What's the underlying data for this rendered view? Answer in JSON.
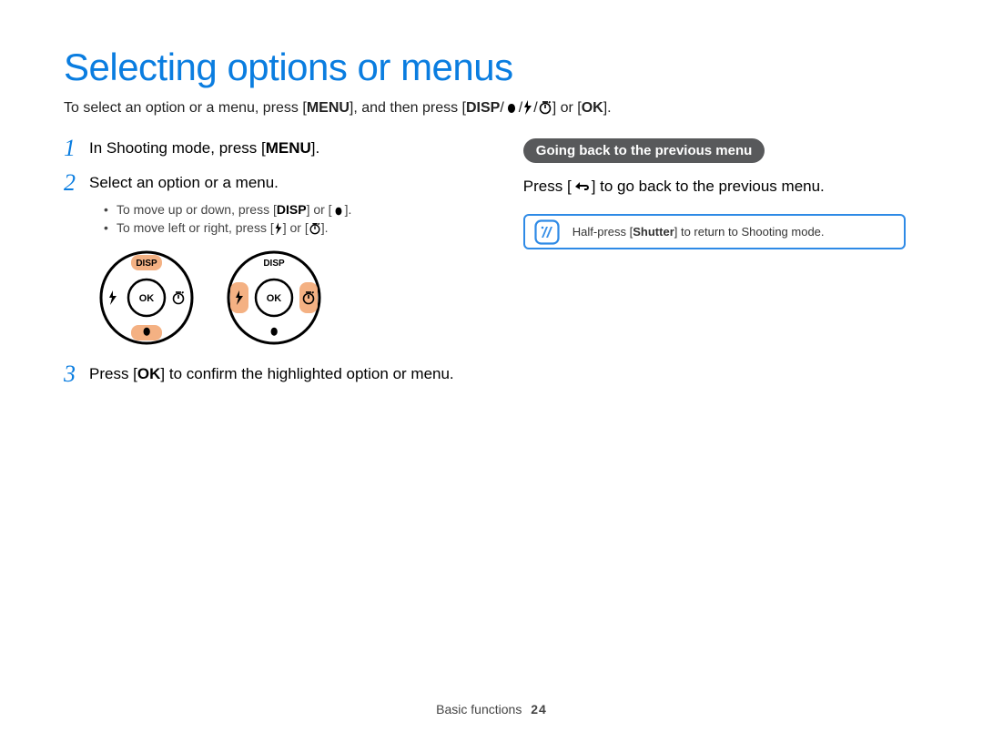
{
  "title": "Selecting options or menus",
  "intro": {
    "p1": "To select an option or a menu, press [",
    "menu": "MENU",
    "p2": "], and then press [",
    "disp": "DISP",
    "p3": "] or [",
    "ok": "OK",
    "p4": "]."
  },
  "steps": {
    "s1": {
      "num": "1",
      "t1": "In Shooting mode, press [",
      "menu": "MENU",
      "t2": "]."
    },
    "s2": {
      "num": "2",
      "text": "Select an option or a menu.",
      "b1": {
        "a": "To move up or down, press [",
        "disp": "DISP",
        "b": "] or [",
        "c": "]."
      },
      "b2": {
        "a": "To move left or right, press [",
        "b": "] or [",
        "c": "]."
      }
    },
    "s3": {
      "num": "3",
      "t1": "Press [",
      "ok": "OK",
      "t2": "] to confirm the highlighted option or menu."
    }
  },
  "diagrams": {
    "disp": "DISP",
    "ok": "OK"
  },
  "right": {
    "pill": "Going back to the previous menu",
    "body1": "Press [",
    "body2": "] to go back to the previous menu.",
    "note1": "Half-press [",
    "shutter": "Shutter",
    "note2": "] to return to Shooting mode."
  },
  "footer": {
    "section": "Basic functions",
    "page": "24"
  }
}
